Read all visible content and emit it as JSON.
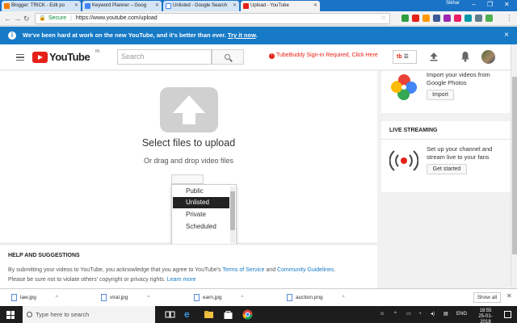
{
  "browser": {
    "tabs": [
      {
        "label": "Blogger: TRICK - Edit po",
        "favicon_color": "#f57d00"
      },
      {
        "label": "Keyword Planner – Goog",
        "favicon_color": "#4285f4"
      },
      {
        "label": "Unlisted - Google Search",
        "favicon_color": "#ffffff"
      },
      {
        "label": "Upload - YouTube",
        "favicon_color": "#e62117"
      }
    ],
    "profile_name": "Sikhar",
    "secure_label": "Secure",
    "url": "https://www.youtube.com/upload"
  },
  "banner": {
    "message": "We've been hard at work on the new YouTube, and it's better than ever.",
    "link": "Try it now",
    "close": "×"
  },
  "header": {
    "logo_text": "YouTube",
    "country": "IN",
    "search_placeholder": "Search",
    "tubebuddy_warning": "TubeBuddy Sign-in Required, Click Here",
    "tubebuddy_button": "tb"
  },
  "upload": {
    "title": "Select files to upload",
    "subtitle": "Or drag and drop video files",
    "privacy_options": [
      "Public",
      "Unlisted",
      "Private",
      "Scheduled"
    ],
    "selected_privacy": "Unlisted"
  },
  "sidebar": {
    "import": {
      "text": "Import your videos from Google Photos",
      "button": "Import"
    },
    "live": {
      "heading": "LIVE STREAMING",
      "text": "Set up your channel and stream live to your fans",
      "button": "Get started"
    }
  },
  "help": {
    "heading": "HELP AND SUGGESTIONS",
    "line1_prefix": "By submitting your videos to YouTube, you acknowledge that you agree to YouTube's",
    "terms_link": "Terms of Service",
    "and": "and",
    "guidelines_link": "Community Guidelines",
    "line2_prefix": "Please be sure not to violate others' copyright or privacy rights.",
    "learn_more": "Learn more"
  },
  "downloads": {
    "files": [
      "law.jpg",
      "viral.jpg",
      "earn.jpg",
      "auction.png"
    ],
    "show_all": "Show all"
  },
  "taskbar": {
    "search_placeholder": "Type here to search",
    "language": "ENG",
    "time": "18:55",
    "date": "25-01-2018"
  },
  "colors": {
    "youtube_red": "#e62117",
    "banner_blue": "#167ac6",
    "link_blue": "#167ac6"
  }
}
